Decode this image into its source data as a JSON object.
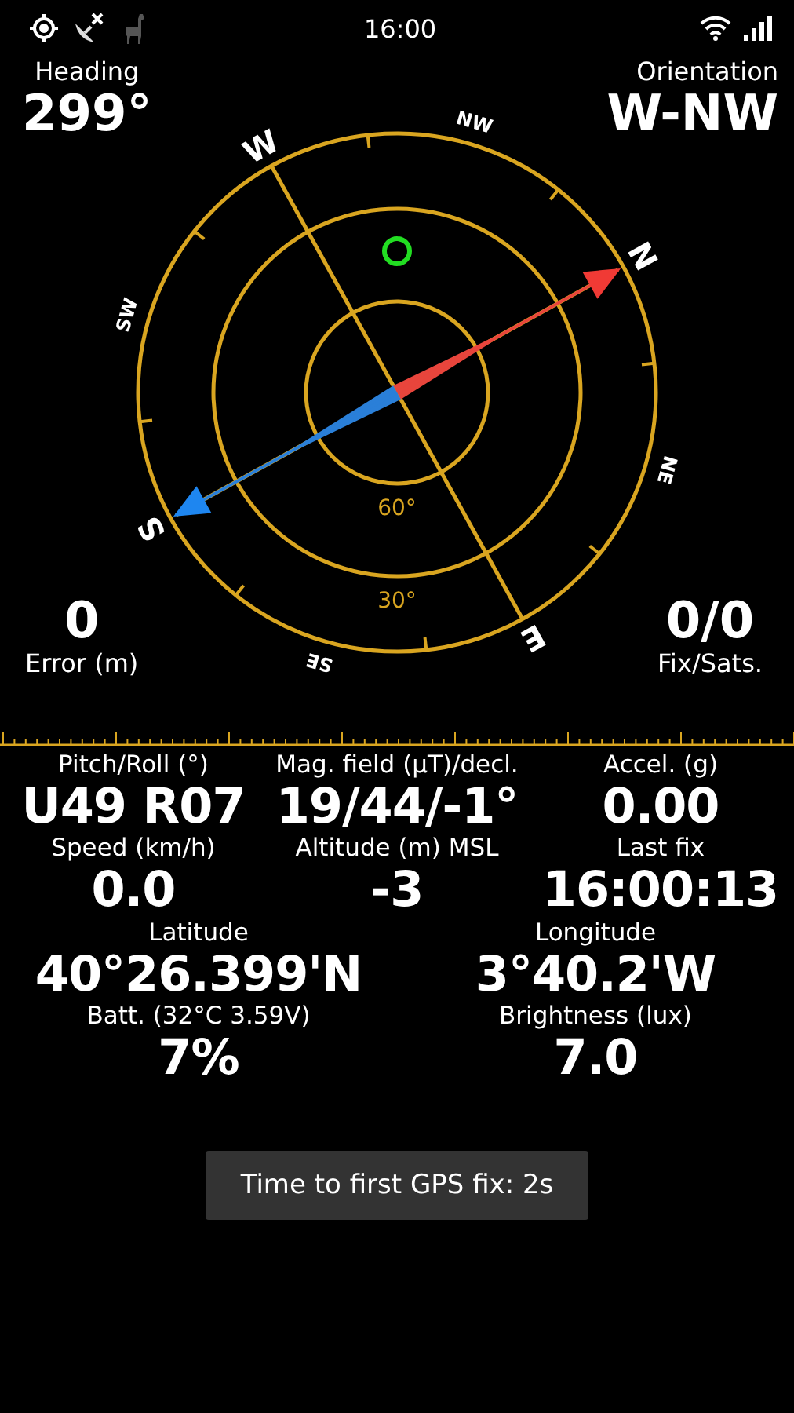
{
  "status_bar": {
    "time": "16:00"
  },
  "compass": {
    "heading": {
      "label": "Heading",
      "value": "299°"
    },
    "orientation": {
      "label": "Orientation",
      "value": "W-NW"
    },
    "error": {
      "label": "Error (m)",
      "value": "0"
    },
    "fix": {
      "label": "Fix/Sats.",
      "value": "0/0"
    },
    "directions": [
      "N",
      "NE",
      "E",
      "SE",
      "S",
      "SW",
      "W",
      "NW"
    ],
    "ring_labels": [
      "60°",
      "30°"
    ]
  },
  "readings": [
    [
      {
        "label": "Pitch/Roll (°)",
        "value": "U49 R07"
      },
      {
        "label": "Mag. field (µT)/decl.",
        "value": "19/44/-1°"
      },
      {
        "label": "Accel. (g)",
        "value": "0.00"
      }
    ],
    [
      {
        "label": "Speed (km/h)",
        "value": "0.0"
      },
      {
        "label": "Altitude (m) MSL",
        "value": "-3"
      },
      {
        "label": "Last fix",
        "value": "16:00:13"
      }
    ],
    [
      {
        "label": "Latitude",
        "value": "40°26.399'N"
      },
      {
        "label": "Longitude",
        "value": "3°40.2'W"
      }
    ],
    [
      {
        "label": "Batt. (32°C 3.59V)",
        "value": "7%"
      },
      {
        "label": "Brightness (lux)",
        "value": "7.0"
      }
    ]
  ],
  "toast": "Time to first GPS fix: 2s"
}
